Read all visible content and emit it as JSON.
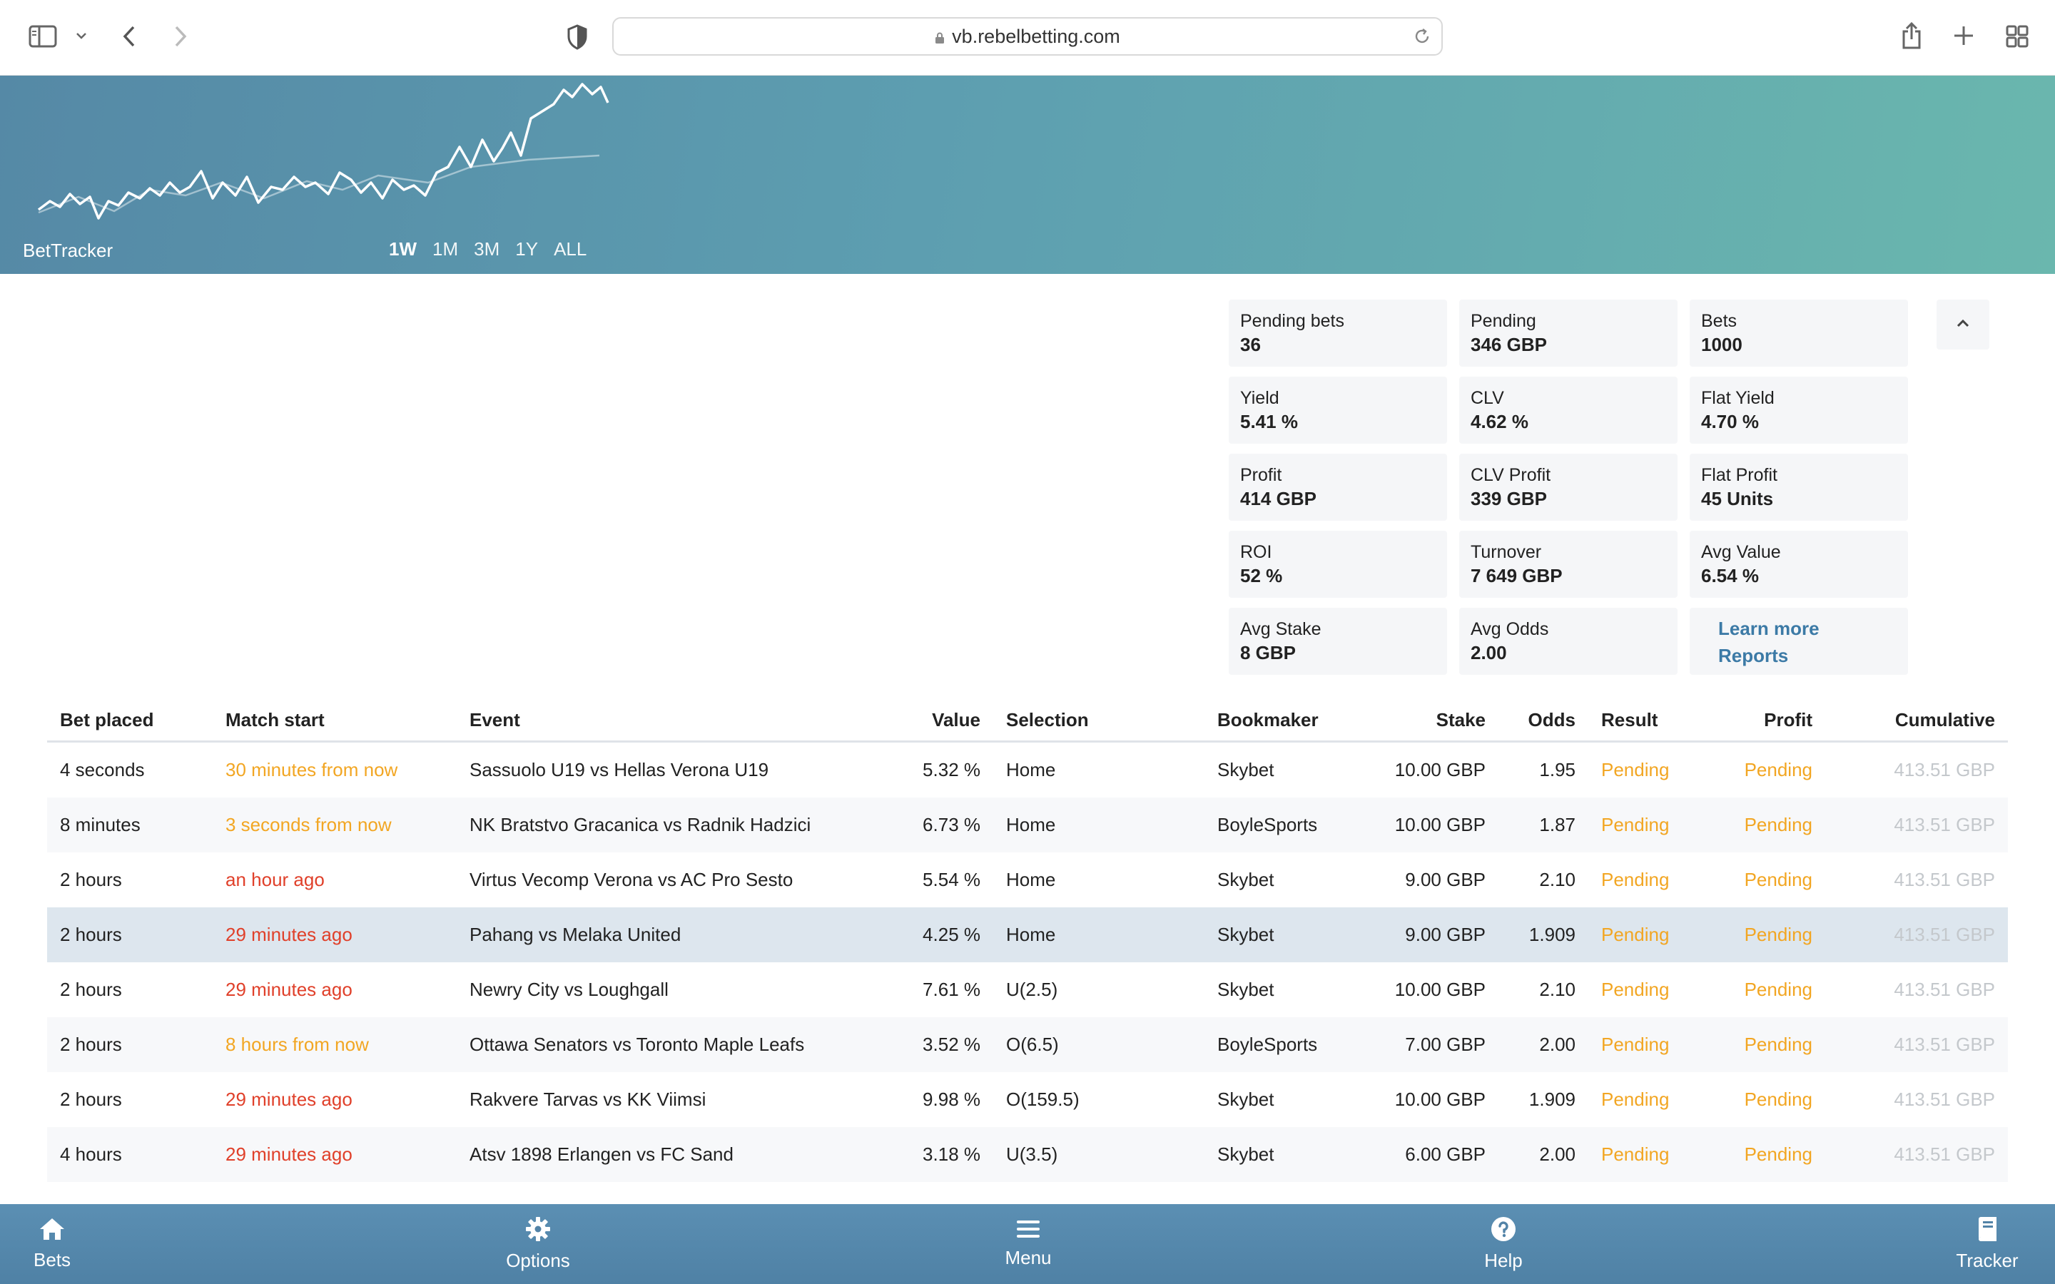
{
  "browser": {
    "url": "vb.rebelbetting.com"
  },
  "header": {
    "brand": "BetTracker",
    "ranges": [
      "1W",
      "1M",
      "3M",
      "1Y",
      "ALL"
    ],
    "active_range": "1W"
  },
  "stats": {
    "pending_bets": {
      "label": "Pending bets",
      "value": "36"
    },
    "pending": {
      "label": "Pending",
      "value": "346 GBP"
    },
    "bets": {
      "label": "Bets",
      "value": "1000"
    },
    "yield": {
      "label": "Yield",
      "value": "5.41 %"
    },
    "clv": {
      "label": "CLV",
      "value": "4.62 %"
    },
    "flat_yield": {
      "label": "Flat Yield",
      "value": "4.70 %"
    },
    "profit": {
      "label": "Profit",
      "value": "414 GBP"
    },
    "clv_profit": {
      "label": "CLV Profit",
      "value": "339 GBP"
    },
    "flat_profit": {
      "label": "Flat Profit",
      "value": "45 Units"
    },
    "roi": {
      "label": "ROI",
      "value": "52 %"
    },
    "turnover": {
      "label": "Turnover",
      "value": "7 649 GBP"
    },
    "avg_value": {
      "label": "Avg Value",
      "value": "6.54 %"
    },
    "avg_stake": {
      "label": "Avg Stake",
      "value": "8 GBP"
    },
    "avg_odds": {
      "label": "Avg Odds",
      "value": "2.00"
    },
    "learn_more": "Learn more",
    "reports": "Reports"
  },
  "table": {
    "headers": {
      "bet_placed": "Bet placed",
      "match_start": "Match start",
      "event": "Event",
      "value": "Value",
      "selection": "Selection",
      "bookmaker": "Bookmaker",
      "stake": "Stake",
      "odds": "Odds",
      "result": "Result",
      "profit": "Profit",
      "cumulative": "Cumulative"
    },
    "rows": [
      {
        "bet_placed": "4 seconds",
        "match_start": "30 minutes from now",
        "event": "Sassuolo U19 vs Hellas Verona U19",
        "value": "5.32 %",
        "selection": "Home",
        "bookmaker": "Skybet",
        "stake": "10.00 GBP",
        "odds": "1.95",
        "result": "Pending",
        "profit": "Pending",
        "cumulative": "413.51 GBP"
      },
      {
        "bet_placed": "8 minutes",
        "match_start": "3 seconds from now",
        "event": "NK Bratstvo Gracanica vs Radnik Hadzici",
        "value": "6.73 %",
        "selection": "Home",
        "bookmaker": "BoyleSports",
        "stake": "10.00 GBP",
        "odds": "1.87",
        "result": "Pending",
        "profit": "Pending",
        "cumulative": "413.51 GBP"
      },
      {
        "bet_placed": "2 hours",
        "match_start": "an hour ago",
        "event": "Virtus Vecomp Verona vs AC Pro Sesto",
        "value": "5.54 %",
        "selection": "Home",
        "bookmaker": "Skybet",
        "stake": "9.00 GBP",
        "odds": "2.10",
        "result": "Pending",
        "profit": "Pending",
        "cumulative": "413.51 GBP"
      },
      {
        "bet_placed": "2 hours",
        "match_start": "29 minutes ago",
        "event": "Pahang vs Melaka United",
        "value": "4.25 %",
        "selection": "Home",
        "bookmaker": "Skybet",
        "stake": "9.00 GBP",
        "odds": "1.909",
        "result": "Pending",
        "profit": "Pending",
        "cumulative": "413.51 GBP"
      },
      {
        "bet_placed": "2 hours",
        "match_start": "29 minutes ago",
        "event": "Newry City vs Loughgall",
        "value": "7.61 %",
        "selection": "U(2.5)",
        "bookmaker": "Skybet",
        "stake": "10.00 GBP",
        "odds": "2.10",
        "result": "Pending",
        "profit": "Pending",
        "cumulative": "413.51 GBP"
      },
      {
        "bet_placed": "2 hours",
        "match_start": "8 hours from now",
        "event": "Ottawa Senators vs Toronto Maple Leafs",
        "value": "3.52 %",
        "selection": "O(6.5)",
        "bookmaker": "BoyleSports",
        "stake": "7.00 GBP",
        "odds": "2.00",
        "result": "Pending",
        "profit": "Pending",
        "cumulative": "413.51 GBP"
      },
      {
        "bet_placed": "2 hours",
        "match_start": "29 minutes ago",
        "event": "Rakvere Tarvas vs KK Viimsi",
        "value": "9.98 %",
        "selection": "O(159.5)",
        "bookmaker": "Skybet",
        "stake": "10.00 GBP",
        "odds": "1.909",
        "result": "Pending",
        "profit": "Pending",
        "cumulative": "413.51 GBP"
      },
      {
        "bet_placed": "4 hours",
        "match_start": "29 minutes ago",
        "event": "Atsv 1898 Erlangen vs FC Sand",
        "value": "3.18 %",
        "selection": "U(3.5)",
        "bookmaker": "Skybet",
        "stake": "6.00 GBP",
        "odds": "2.00",
        "result": "Pending",
        "profit": "Pending",
        "cumulative": "413.51 GBP"
      }
    ]
  },
  "bottom_nav": {
    "bets": "Bets",
    "options": "Options",
    "menu": "Menu",
    "help": "Help",
    "tracker": "Tracker"
  },
  "colors": {
    "future_start": "#f2a623",
    "past_start": "#e0402a",
    "pending": "#f2a623",
    "cumulative": "#c4c8cc",
    "link": "#3c7aa6",
    "nav_bg": "#4f81a5"
  }
}
